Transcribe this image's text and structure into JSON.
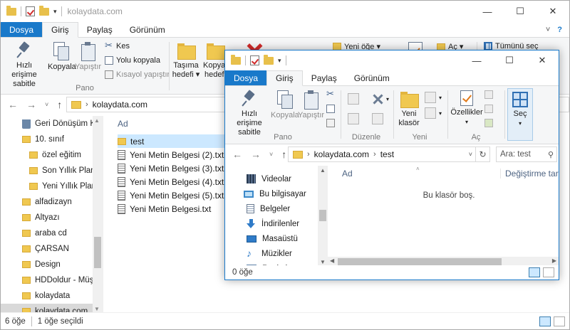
{
  "back_window": {
    "title": "kolaydata.com",
    "tabs": [
      "Dosya",
      "Giriş",
      "Paylaş",
      "Görünüm"
    ],
    "ribbon": {
      "pin_label": "Hızlı erişime sabitle",
      "copy_label": "Kopyala",
      "paste_label": "Yapıştır",
      "cut_label": "Kes",
      "copy_path_label": "Yolu kopyala",
      "paste_shortcut_label": "Kısayol yapıştır",
      "group_clipboard": "Pano",
      "move_to_label": "Taşıma hedefi ▾",
      "copy_to_label": "Kopyala hedefi",
      "new_item_label": "Yeni öğe ▾",
      "open_label": "Aç ▾",
      "select_all_label": "Tümünü seç"
    },
    "address": "kolaydata.com",
    "nav_items": [
      {
        "label": "Geri Dönüşüm Ku",
        "icon": "recycle-bin-icon",
        "level": 0
      },
      {
        "label": "10. sınıf",
        "icon": "folder-icon",
        "level": 0
      },
      {
        "label": "özel eğitim",
        "icon": "folder-icon",
        "level": 1
      },
      {
        "label": "Son Yıllık Planla",
        "icon": "folder-icon",
        "level": 1
      },
      {
        "label": "Yeni Yıllık Planla",
        "icon": "folder-icon",
        "level": 1
      },
      {
        "label": "alfadizayn",
        "icon": "folder-icon",
        "level": 0
      },
      {
        "label": "Altyazı",
        "icon": "folder-icon",
        "level": 0
      },
      {
        "label": "araba cd",
        "icon": "folder-icon",
        "level": 0
      },
      {
        "label": "ÇARSAN",
        "icon": "folder-icon",
        "level": 0
      },
      {
        "label": "Design",
        "icon": "folder-icon",
        "level": 0
      },
      {
        "label": "HDDoldur - Müşt",
        "icon": "folder-icon",
        "level": 0
      },
      {
        "label": "kolaydata",
        "icon": "folder-icon",
        "level": 0
      },
      {
        "label": "kolaydata.com",
        "icon": "folder-icon",
        "level": 0,
        "selected": true
      }
    ],
    "column_name": "Ad",
    "files": [
      {
        "name": "test",
        "type": "folder",
        "selected": true
      },
      {
        "name": "Yeni Metin Belgesi (2).txt",
        "type": "txt"
      },
      {
        "name": "Yeni Metin Belgesi (3).txt",
        "type": "txt"
      },
      {
        "name": "Yeni Metin Belgesi (4).txt",
        "type": "txt"
      },
      {
        "name": "Yeni Metin Belgesi (5).txt",
        "type": "txt"
      },
      {
        "name": "Yeni Metin Belgesi.txt",
        "type": "txt"
      }
    ],
    "status": {
      "count": "6 öğe",
      "selected": "1 öğe seçildi"
    }
  },
  "front_window": {
    "tabs": [
      "Dosya",
      "Giriş",
      "Paylaş",
      "Görünüm"
    ],
    "ribbon": {
      "pin_label": "Hızlı erişime sabitle",
      "copy_label": "Kopyala",
      "paste_label": "Yapıştır",
      "group_clipboard": "Pano",
      "group_organize": "Düzenle",
      "new_folder_label": "Yeni klasör",
      "group_new": "Yeni",
      "properties_label": "Özellikler",
      "group_open": "Aç",
      "select_label": "Seç"
    },
    "breadcrumb": [
      "kolaydata.com",
      "test"
    ],
    "search_placeholder": "Ara: test",
    "nav_items": [
      {
        "label": "Videolar",
        "icon": "videos-icon"
      },
      {
        "label": "Bu bilgisayar",
        "icon": "this-pc-icon"
      },
      {
        "label": "Belgeler",
        "icon": "documents-icon"
      },
      {
        "label": "İndirilenler",
        "icon": "downloads-icon"
      },
      {
        "label": "Masaüstü",
        "icon": "desktop-icon"
      },
      {
        "label": "Müzikler",
        "icon": "music-icon"
      },
      {
        "label": "Resimler",
        "icon": "pictures-icon"
      }
    ],
    "column_name": "Ad",
    "column_modified": "Değiştirme tarihi",
    "empty_message": "Bu klasör boş.",
    "status": {
      "count": "0 öğe"
    }
  },
  "colors": {
    "accent": "#1979ca",
    "folder": "#f0c850",
    "selection": "#cce8ff"
  }
}
